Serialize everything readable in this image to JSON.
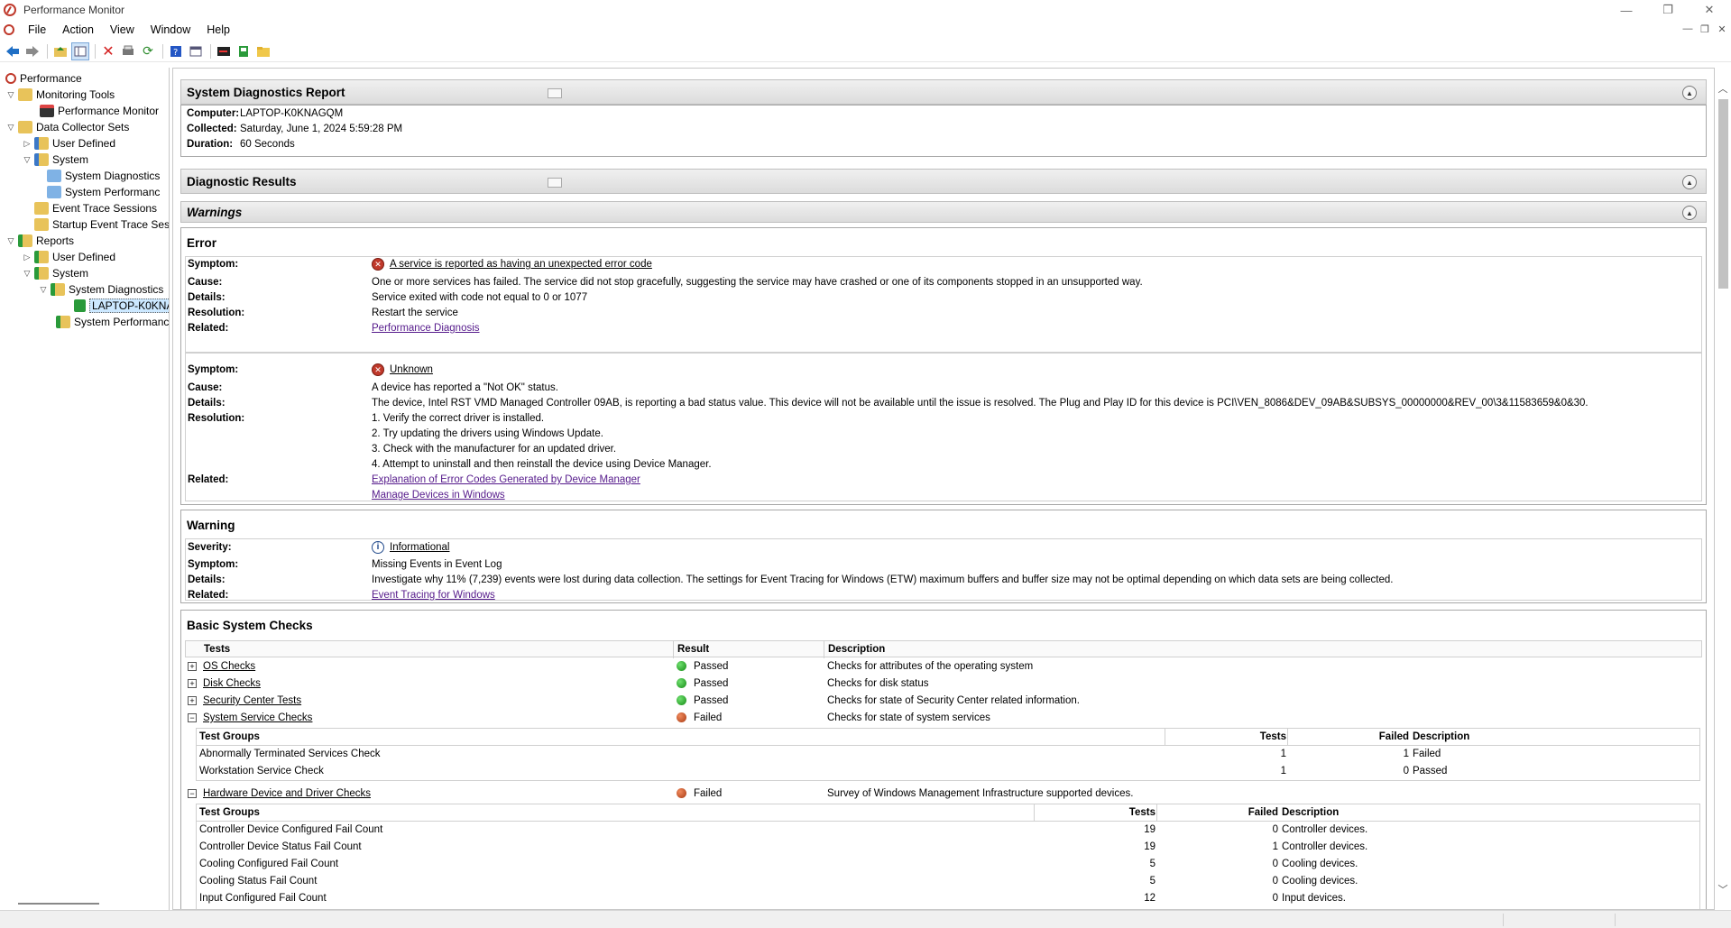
{
  "window": {
    "title": "Performance Monitor",
    "controls": [
      "—",
      "❐",
      "✕"
    ]
  },
  "menu": [
    "File",
    "Action",
    "View",
    "Window",
    "Help"
  ],
  "toolbar": {
    "icons": [
      "back-icon",
      "forward-icon",
      "up-folder-icon",
      "show-hide-tree-icon",
      "delete-icon",
      "export-icon",
      "refresh-icon",
      "help-icon",
      "properties-icon",
      "console-icon",
      "new-report-icon",
      "open-folder-icon"
    ]
  },
  "tree": {
    "items": [
      {
        "label": "Performance",
        "level": 0
      },
      {
        "label": "Monitoring Tools",
        "level": 1
      },
      {
        "label": "Performance Monitor",
        "level": 2
      },
      {
        "label": "Data Collector Sets",
        "level": 1
      },
      {
        "label": "User Defined",
        "level": 2
      },
      {
        "label": "System",
        "level": 2
      },
      {
        "label": "System Diagnostics",
        "level": 3
      },
      {
        "label": "System Performanc",
        "level": 3
      },
      {
        "label": "Event Trace Sessions",
        "level": 2
      },
      {
        "label": "Startup Event Trace Sess",
        "level": 2
      },
      {
        "label": "Reports",
        "level": 1
      },
      {
        "label": "User Defined",
        "level": 2
      },
      {
        "label": "System",
        "level": 2
      },
      {
        "label": "System Diagnostics",
        "level": 3
      },
      {
        "label": "LAPTOP-K0KNA",
        "level": 4
      },
      {
        "label": "System Performanc",
        "level": 3
      }
    ]
  },
  "report": {
    "title": "System Diagnostics Report",
    "computer_label": "Computer:",
    "computer": "LAPTOP-K0KNAGQM",
    "collected_label": "Collected:",
    "collected": "Saturday, June 1, 2024 5:59:28 PM",
    "duration_label": "Duration:",
    "duration": "60 Seconds",
    "diag_title": "Diagnostic Results",
    "warnings_title": "Warnings"
  },
  "error": {
    "title": "Error",
    "labels": {
      "symptom": "Symptom:",
      "cause": "Cause:",
      "details": "Details:",
      "resolution": "Resolution:",
      "related": "Related:"
    },
    "e1": {
      "symptom": "A service is reported as having an unexpected error code",
      "cause": "One or more services has failed. The service did not stop gracefully, suggesting the service may have crashed or one of its components stopped in an unsupported way.",
      "details": "Service exited with code not equal to 0 or 1077",
      "resolution": "Restart the service",
      "related": "Performance Diagnosis"
    },
    "e2": {
      "symptom": "Unknown",
      "cause": "A device has reported a \"Not OK\" status.",
      "details": "The device, Intel RST VMD Managed Controller 09AB, is reporting a bad status value. This device will not be available until the issue is resolved. The Plug and Play ID for this device is PCI\\VEN_8086&DEV_09AB&SUBSYS_00000000&REV_00\\3&11583659&0&30.",
      "resolution": [
        "1. Verify the correct driver is installed.",
        "2. Try updating the drivers using Windows Update.",
        "3. Check with the manufacturer for an updated driver.",
        "4. Attempt to uninstall and then reinstall the device using Device Manager."
      ],
      "related": [
        "Explanation of Error Codes Generated by Device Manager",
        "Manage Devices in Windows"
      ]
    }
  },
  "warning": {
    "title": "Warning",
    "severity_label": "Severity:",
    "severity": "Informational",
    "symptom_label": "Symptom:",
    "symptom": "Missing Events in Event Log",
    "details_label": "Details:",
    "details": "Investigate why 11% (7,239) events were lost during data collection. The settings for Event Tracing for Windows (ETW) maximum buffers and buffer size may not be optimal depending on which data sets are being collected.",
    "related_label": "Related:",
    "related": "Event Tracing for Windows"
  },
  "checks": {
    "title": "Basic System Checks",
    "headers": {
      "tests": "Tests",
      "result": "Result",
      "description": "Description"
    },
    "rows": [
      {
        "name": "OS Checks",
        "result": "Passed",
        "status": "pass",
        "description": "Checks for attributes of the operating system",
        "expander": "+"
      },
      {
        "name": "Disk Checks",
        "result": "Passed",
        "status": "pass",
        "description": "Checks for disk status",
        "expander": "+"
      },
      {
        "name": "Security Center Tests",
        "result": "Passed",
        "status": "pass",
        "description": "Checks for state of Security Center related information.",
        "expander": "+"
      },
      {
        "name": "System Service Checks",
        "result": "Failed",
        "status": "fail",
        "description": "Checks for state of system services",
        "expander": "−"
      },
      {
        "name": "Hardware Device and Driver Checks",
        "result": "Failed",
        "status": "fail",
        "description": "Survey of Windows Management Infrastructure supported devices.",
        "expander": "−"
      }
    ],
    "sub_headers": {
      "groups": "Test Groups",
      "tests": "Tests",
      "failed": "Failed",
      "description": "Description"
    },
    "service_groups": [
      {
        "name": "Abnormally Terminated Services Check",
        "tests": "1",
        "failed": "1",
        "description": "Failed"
      },
      {
        "name": "Workstation Service Check",
        "tests": "1",
        "failed": "0",
        "description": "Passed"
      }
    ],
    "hardware_groups": [
      {
        "name": "Controller Device Configured Fail Count",
        "tests": "19",
        "failed": "0",
        "description": "Controller devices."
      },
      {
        "name": "Controller Device Status Fail Count",
        "tests": "19",
        "failed": "1",
        "description": "Controller devices."
      },
      {
        "name": "Cooling Configured Fail Count",
        "tests": "5",
        "failed": "0",
        "description": "Cooling devices."
      },
      {
        "name": "Cooling Status Fail Count",
        "tests": "5",
        "failed": "0",
        "description": "Cooling devices."
      },
      {
        "name": "Input Configured Fail Count",
        "tests": "12",
        "failed": "0",
        "description": "Input devices."
      }
    ]
  }
}
